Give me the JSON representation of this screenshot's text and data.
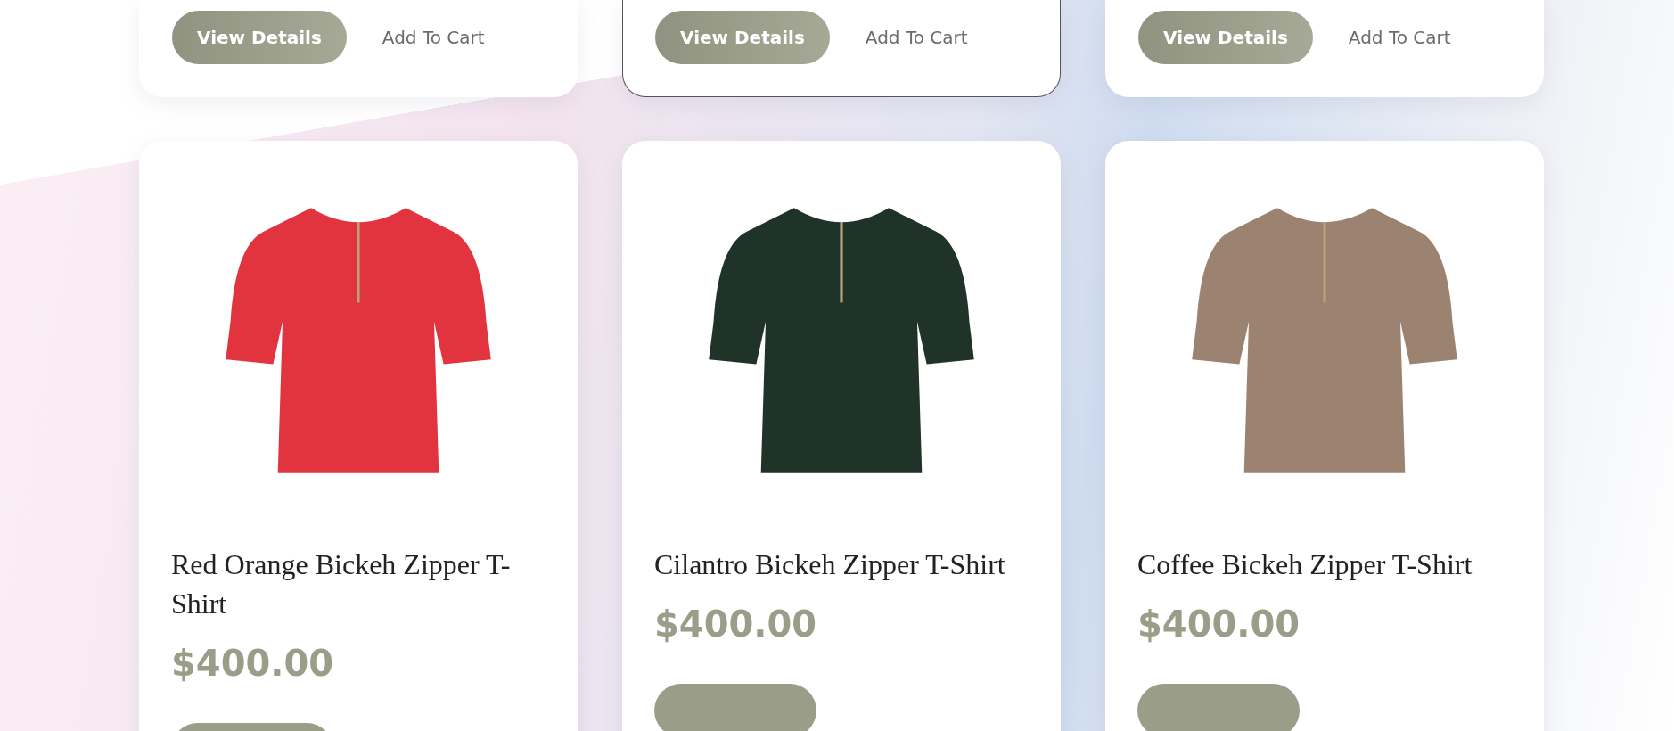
{
  "top_cards": [
    {
      "hovered": false,
      "buttons": {
        "view_details": "View Details",
        "add_to_cart": "Add To Cart"
      }
    },
    {
      "hovered": true,
      "buttons": {
        "view_details": "View Details",
        "add_to_cart": "Add To Cart"
      }
    },
    {
      "hovered": false,
      "buttons": {
        "view_details": "View Details",
        "add_to_cart": "Add To Cart"
      }
    }
  ],
  "products": [
    {
      "name": "Red Orange Bickeh Zipper T-Shirt",
      "price": "$400.00",
      "color": "#e2343f"
    },
    {
      "name": "Cilantro Bickeh Zipper T-Shirt",
      "price": "$400.00",
      "color": "#1f3329"
    },
    {
      "name": "Coffee Bickeh Zipper T-Shirt",
      "price": "$400.00",
      "color": "#9c8271"
    }
  ]
}
